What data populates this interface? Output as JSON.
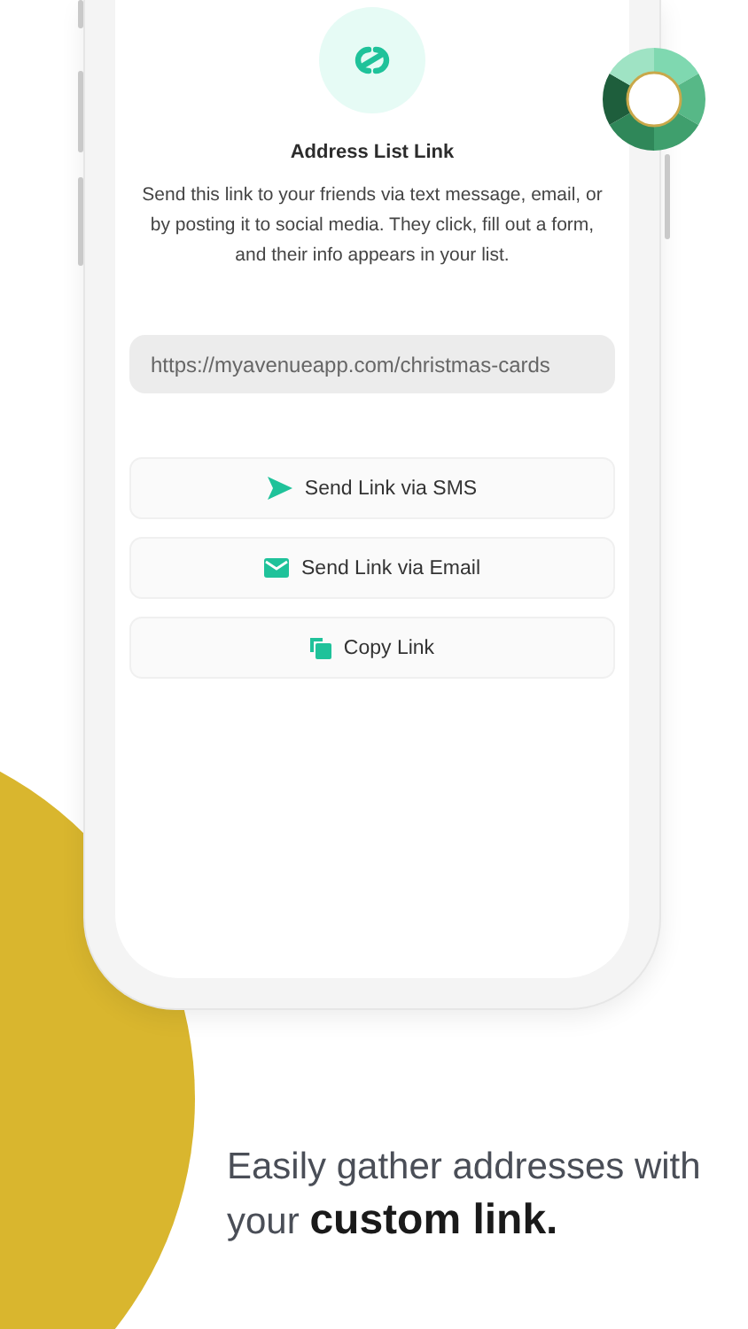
{
  "screen": {
    "title": "Address List Link",
    "description": "Send this link to your friends via text message, email, or by posting it to social media. They click, fill out a form, and their info appears in your list.",
    "link_field": {
      "value": "https://myavenueapp.com/christmas-cards"
    },
    "actions": [
      {
        "kind": "sms",
        "label": "Send Link via SMS"
      },
      {
        "kind": "email",
        "label": "Send Link via Email"
      },
      {
        "kind": "copy",
        "label": "Copy Link"
      }
    ]
  },
  "caption": "Easily gather addresses with your **custom link.**"
}
